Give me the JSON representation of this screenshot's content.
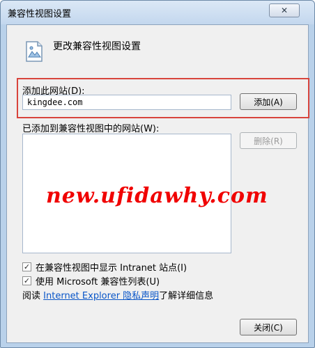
{
  "window": {
    "title": "兼容性视图设置",
    "close_glyph": "✕"
  },
  "header": {
    "icon": "picture-settings-icon",
    "text": "更改兼容性视图设置"
  },
  "add_site": {
    "label": "添加此网站(D):",
    "input_value": "kingdee.com",
    "add_button": "添加(A)",
    "highlight_color": "#d8443c"
  },
  "added_sites": {
    "label": "已添加到兼容性视图中的网站(W):",
    "items": [],
    "remove_button": "删除(R)"
  },
  "watermark": {
    "text": "new.ufidawhy.com",
    "color": "#f00000"
  },
  "options": {
    "intranet": {
      "label": "在兼容性视图中显示 Intranet 站点(I)",
      "checked": true
    },
    "microsoft_list": {
      "label": "使用 Microsoft 兼容性列表(U)",
      "checked": true
    }
  },
  "privacy": {
    "prefix": "阅读",
    "link": "Internet Explorer 隐私声明",
    "suffix": "了解详细信息"
  },
  "footer": {
    "close_button": "关闭(C)"
  }
}
